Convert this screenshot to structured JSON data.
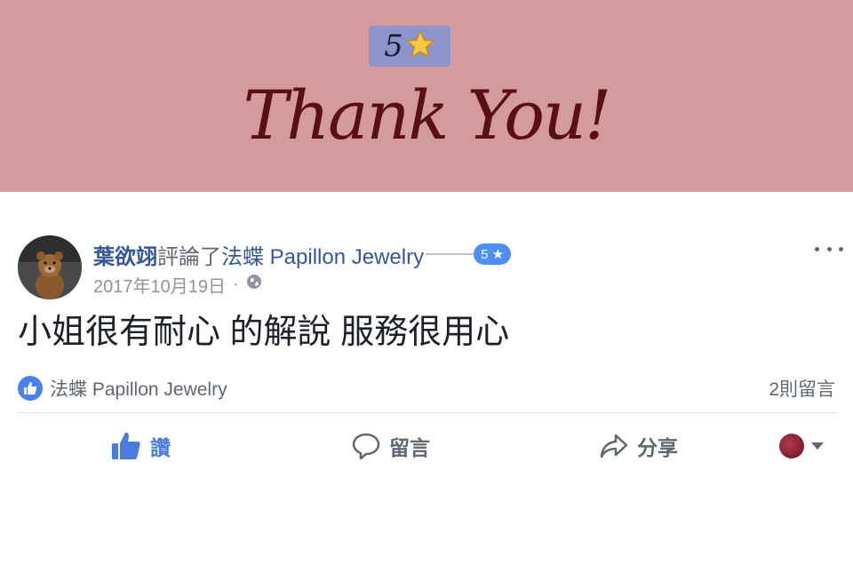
{
  "banner": {
    "rating_number": "5",
    "headline": "Thank You!"
  },
  "post": {
    "author": "葉欲翊",
    "action": "評論了",
    "page": "法蝶 Papillon Jewelry",
    "rating_badge": "5 ★",
    "date": "2017年10月19日",
    "meta_separator": "·",
    "text": "小姐很有耐心 的解說 服務很用心"
  },
  "reactions": {
    "liked_by": "法蝶 Papillon Jewelry",
    "comment_count": "2則留言"
  },
  "actions": {
    "like_label": "讚",
    "comment_label": "留言",
    "share_label": "分享"
  },
  "colors": {
    "banner_bg": "#d39b9b",
    "link_blue": "#365899",
    "accent_blue": "#4a80f0"
  }
}
